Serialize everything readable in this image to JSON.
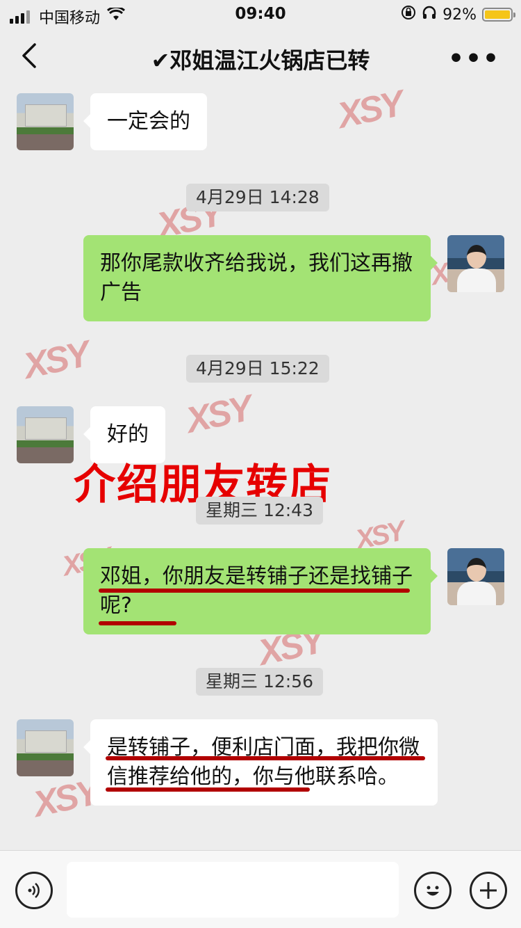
{
  "status": {
    "carrier": "中国移动",
    "time": "09:40",
    "battery": "92%",
    "signal_icon": "cellular-signal-icon",
    "wifi_icon": "wifi-icon"
  },
  "nav": {
    "title": "✔邓姐温江火锅店已转",
    "more": "•••"
  },
  "watermark": "XSY",
  "messages": [
    {
      "side": "in",
      "text": "一定会的"
    },
    {
      "type": "time",
      "text": "4月29日 14:28"
    },
    {
      "side": "out",
      "text": "那你尾款收齐给我说，我们这再撤广告"
    },
    {
      "type": "time",
      "text": "4月29日 15:22"
    },
    {
      "side": "in",
      "text": "好的"
    },
    {
      "type": "time",
      "text": "星期三 12:43"
    },
    {
      "side": "out",
      "text": "邓姐，你朋友是转铺子还是找铺子呢?"
    },
    {
      "type": "time",
      "text": "星期三 12:56"
    },
    {
      "side": "in",
      "text": "是转铺子，便利店门面，我把你微信推荐给他的，你与他联系哈。"
    }
  ],
  "overlay_text": "介绍朋友转店",
  "annotation_color": "#b10000",
  "bubble_colors": {
    "incoming": "#ffffff",
    "outgoing": "#a3e374"
  },
  "input": {
    "voice_icon": "voice-icon",
    "emoji_icon": "emoji-icon",
    "plus_icon": "plus-icon"
  }
}
